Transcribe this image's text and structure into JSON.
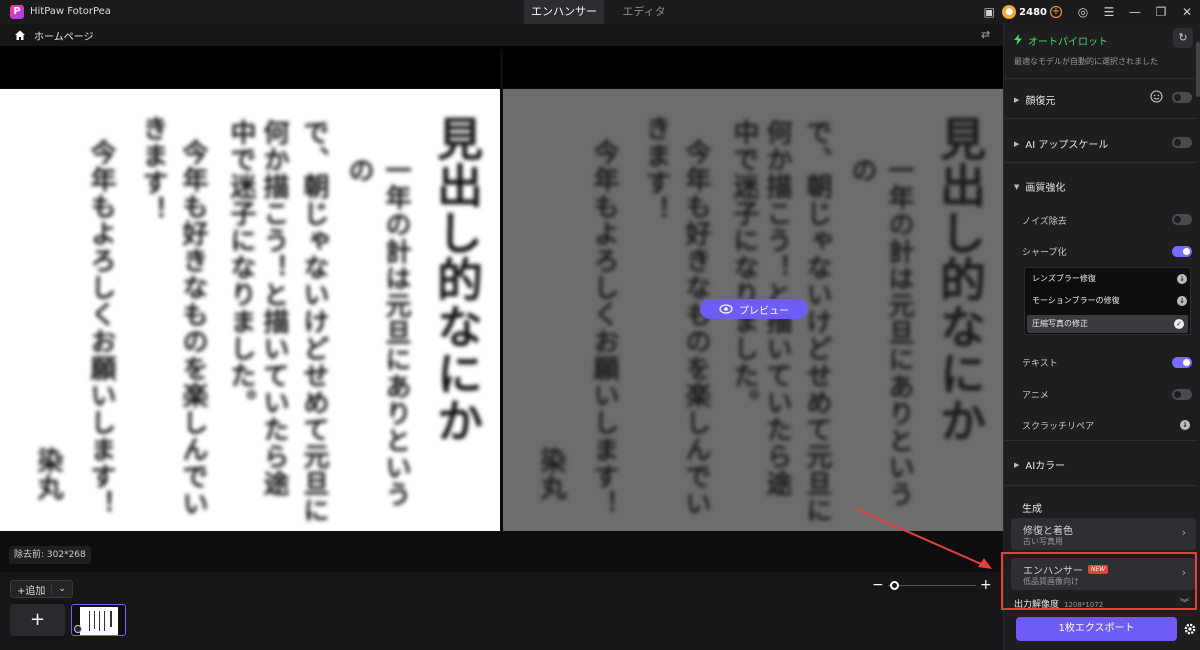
{
  "app": {
    "name": "HitPaw FotorPea"
  },
  "top_tabs": [
    {
      "label": "エンハンサー"
    },
    {
      "label": "エディタ"
    }
  ],
  "titlebar": {
    "coins": "2480"
  },
  "breadcrumb": {
    "home_label": "ホームページ"
  },
  "canvas": {
    "left_lines": [
      "見出し的なにか",
      "一年の計は元旦にありというの",
      "で、朝じゃないけどせめて元旦に",
      "何か描こう！と描いていたら途",
      "中で迷子になりました。",
      "今年も好きなものを楽しんでい",
      "きます！",
      "今年もよろしくお願いします！",
      "染丸"
    ],
    "preview_label": "プレビュー",
    "size_label": "除去前: 302*268"
  },
  "bottom": {
    "add_label": "追加",
    "zoom_value": 0.02
  },
  "panel": {
    "autopilot_label": "オートパイロット",
    "autopilot_desc": "最適なモデルが自動的に選択されました",
    "sections": {
      "face": "顔復元",
      "upscale": "AI アップスケール",
      "quality": "画質強化",
      "noise": "ノイズ除去",
      "sharpen": "シャープ化",
      "text": "テキスト",
      "anime": "アニメ",
      "scratch": "スクラッチリペア",
      "colorize": "AIカラー"
    },
    "sharpen_menu": [
      "レンズブラー修復",
      "モーションブラーの修復",
      "圧縮写真の修正"
    ],
    "generate_label": "生成",
    "cards": [
      {
        "title": "修復と着色",
        "subtitle": "古い写真用"
      },
      {
        "title": "エンハンサー",
        "badge": "NEW",
        "subtitle": "低品質画像向け"
      }
    ],
    "resolution_label": "出力解像度",
    "resolution_value": "1208*1072",
    "export_label": "1枚エクスポート"
  },
  "colors": {
    "accent": "#6d5cf6",
    "autopilot": "#4cd964",
    "highlight": "#e5403a"
  },
  "toggles": {
    "face": false,
    "upscale": false,
    "noise": false,
    "sharpen": true,
    "text": true,
    "anime": false
  }
}
